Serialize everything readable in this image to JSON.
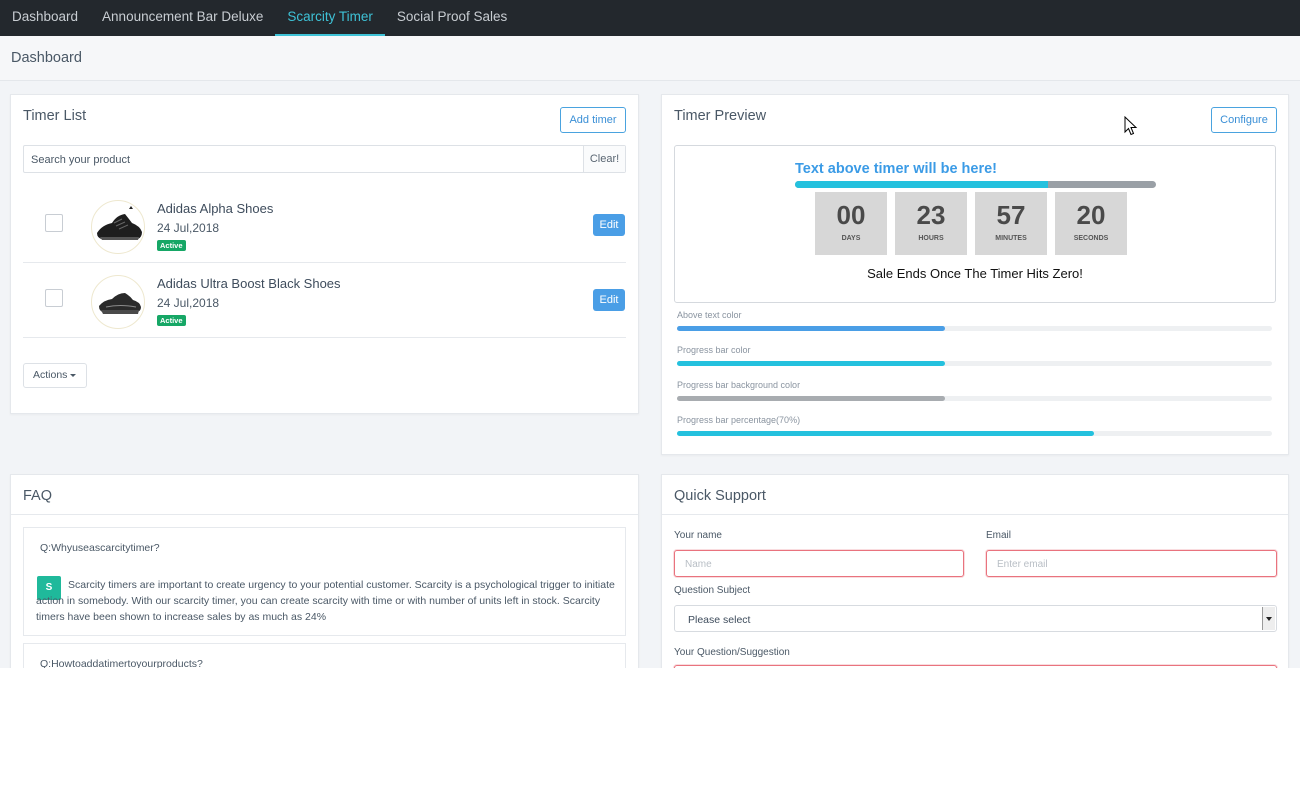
{
  "nav": {
    "items": [
      {
        "label": "Dashboard"
      },
      {
        "label": "Announcement Bar Deluxe"
      },
      {
        "label": "Scarcity Timer",
        "active": true
      },
      {
        "label": "Social Proof Sales"
      }
    ]
  },
  "page_title": "Dashboard",
  "timer_list": {
    "title": "Timer List",
    "add_button": "Add timer",
    "search_placeholder": "Search your product",
    "clear_button": "Clear!",
    "products": [
      {
        "name": "Adidas Alpha Shoes",
        "date": "24 Jul,2018",
        "status": "Active",
        "edit": "Edit"
      },
      {
        "name": "Adidas Ultra Boost Black Shoes",
        "date": "24 Jul,2018",
        "status": "Active",
        "edit": "Edit"
      }
    ],
    "actions_button": "Actions"
  },
  "timer_preview": {
    "title": "Timer Preview",
    "configure_button": "Configure",
    "above_text": "Text above timer will be here!",
    "progress_fraction": 0.7,
    "timer": [
      {
        "value": "00",
        "label": "DAYS"
      },
      {
        "value": "23",
        "label": "HOURS"
      },
      {
        "value": "57",
        "label": "MINUTES"
      },
      {
        "value": "20",
        "label": "SECONDS"
      }
    ],
    "sale_text": "Sale Ends Once The Timer Hits Zero!",
    "settings": [
      {
        "label": "Above text color",
        "value": 0.45,
        "color": "#4a9ee6"
      },
      {
        "label": "Progress bar color",
        "value": 0.45,
        "color": "#24c1de"
      },
      {
        "label": "Progress bar background color",
        "value": 0.45,
        "color": "#a8acb0"
      },
      {
        "label": "Progress bar percentage(70%)",
        "value": 0.7,
        "color": "#24c1de"
      }
    ]
  },
  "faq": {
    "title": "FAQ",
    "items": [
      {
        "question": "Q:Whyuseascarcitytimer?",
        "avatar": "S",
        "answer": "Scarcity timers are important to create urgency to your potential customer. Scarcity is a psychological trigger to initiate action in somebody. With our scarcity timer, you can create scarcity with time or with number of units left in stock. Scarcity timers have been shown to increase sales by as much as 24%"
      },
      {
        "question": "Q:Howtoaddatimertoyourproducts?"
      }
    ]
  },
  "quick_support": {
    "title": "Quick Support",
    "name_label": "Your name",
    "name_placeholder": "Name",
    "email_label": "Email",
    "email_placeholder": "Enter email",
    "subject_label": "Question Subject",
    "subject_value": "Please select",
    "question_label": "Your Question/Suggestion"
  },
  "colors": {
    "accent": "#3ec2d6",
    "nav_bg": "#23282d",
    "primary_button": "#4a9ee6",
    "active_badge": "#16a766",
    "faq_avatar": "#1fb99b",
    "invalid_border": "#e9737e"
  }
}
